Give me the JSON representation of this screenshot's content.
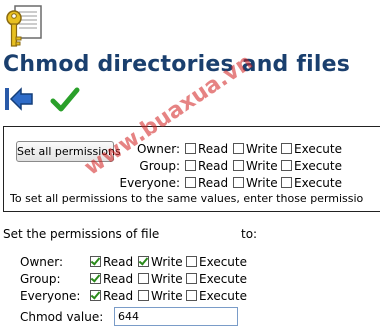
{
  "page": {
    "title": "Chmod directories and files"
  },
  "toolbar": {
    "back_icon": "back-arrow-icon",
    "ok_icon": "checkmark-icon"
  },
  "bulk": {
    "set_all_button": "Set all permissions",
    "rows": [
      {
        "label": "Owner:",
        "read": "Read",
        "write": "Write",
        "execute": "Execute"
      },
      {
        "label": "Group:",
        "read": "Read",
        "write": "Write",
        "execute": "Execute"
      },
      {
        "label": "Everyone:",
        "read": "Read",
        "write": "Write",
        "execute": "Execute"
      }
    ],
    "hint": "To set all permissions to the same values, enter those permissio"
  },
  "single": {
    "set_text": "Set the permissions of file",
    "to_text": "to:",
    "rows": [
      {
        "label": "Owner:",
        "read": "Read",
        "write": "Write",
        "execute": "Execute"
      },
      {
        "label": "Group:",
        "read": "Read",
        "write": "Write",
        "execute": "Execute"
      },
      {
        "label": "Everyone:",
        "read": "Read",
        "write": "Write",
        "execute": "Execute"
      }
    ],
    "chmod_label": "Chmod value:",
    "chmod_value": "644"
  },
  "watermark": "www.buaxua.vn",
  "colors": {
    "title": "#1a3f6e",
    "check": "#2a8a1a",
    "watermark": "#d21f1f"
  }
}
